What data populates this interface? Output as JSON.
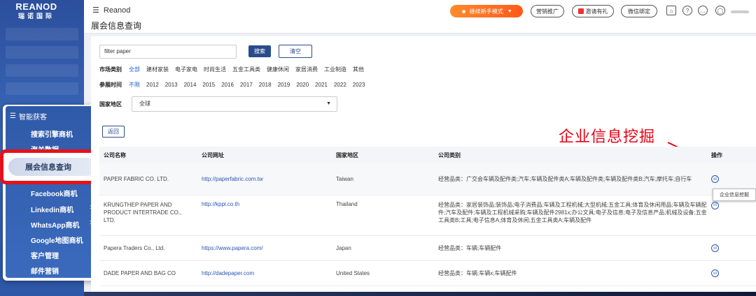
{
  "brand": {
    "logo_en": "REANOD",
    "logo_cn": "瑞诺国际"
  },
  "header": {
    "app_name": "Reanod",
    "page_title": "展会信息查询",
    "novice_mode": "继续新手模式",
    "marketing": "营销推广",
    "invite": "邀请有礼",
    "wechat_bind": "微信绑定"
  },
  "menu": {
    "section": "智能获客",
    "items": [
      {
        "label": "搜索引擎商机",
        "arrow": ""
      },
      {
        "label": "海关数据",
        "arrow": ""
      },
      {
        "label": "展会信息查询",
        "arrow": ""
      },
      {
        "label": "Facebook商机",
        "arrow": ""
      },
      {
        "label": "Linkedin商机",
        "arrow": ">"
      },
      {
        "label": "WhatsApp商机",
        "arrow": ">"
      },
      {
        "label": "Google地图商机",
        "arrow": ""
      },
      {
        "label": "客户管理",
        "arrow": ""
      },
      {
        "label": "邮件营销",
        "arrow": ""
      }
    ]
  },
  "search": {
    "value": "filter paper",
    "search_label": "搜索",
    "clear_label": "清空"
  },
  "filters": {
    "market_label": "市场类别",
    "market_options": [
      "全部",
      "建材家装",
      "电子家电",
      "时尚生活",
      "五金工具类",
      "健康休闲",
      "家居消费",
      "工业制造",
      "其他"
    ],
    "market_selected": "全部",
    "year_label": "参展时间",
    "year_options": [
      "不限",
      "2012",
      "2013",
      "2014",
      "2015",
      "2016",
      "2017",
      "2018",
      "2019",
      "2020",
      "2021",
      "2022",
      "2023"
    ],
    "year_selected": "不限",
    "region_label": "国家地区",
    "region_value": "全球"
  },
  "back_label": "返回",
  "annotation": "企业信息挖掘",
  "table": {
    "headers": {
      "name": "公司名称",
      "url": "公司网址",
      "region": "国家地区",
      "category": "公司类别",
      "op": "操作"
    },
    "rows": [
      {
        "name": "PAPER FABRIC CO. LTD.",
        "url": "http://paperfabric.com.tw",
        "region": "Taiwan",
        "category": "经营品类：广交会车辆及配件类;汽车;车辆及配件类A;车辆及配件类;车辆及配件类B;汽车;摩托车;自行车"
      },
      {
        "name": "KRUNGTHEP PAPER AND PRODUCT INTERTRADE CO., LTD.",
        "url": "http://kppi.co.th",
        "region": "Thailand",
        "category": "经营品类：家居装饰品;装饰品;电子消费品;车辆及工程机械;大型机械;五金工具;体育及休闲用品;车辆及车辆配件;汽车及配件;车辆及工程机械采购;车辆及配件2981x;办公文具;电子及信息;电子及信息产品;机械及设备;五金工具类B;工具;电子信息A;体育及休闲;五金工具类A;车辆及配件"
      },
      {
        "name": "Papera Traders Co., Ltd.",
        "url": "https://www.papera.com/",
        "region": "Japan",
        "category": "经营品类：车辆;车辆配件"
      },
      {
        "name": "DADE PAPER AND BAG CO",
        "url": "http://dadepaper.com",
        "region": "United States",
        "category": "经营品类：车辆;车辆x;车辆配件"
      }
    ]
  },
  "tooltip": "企业信息挖掘"
}
